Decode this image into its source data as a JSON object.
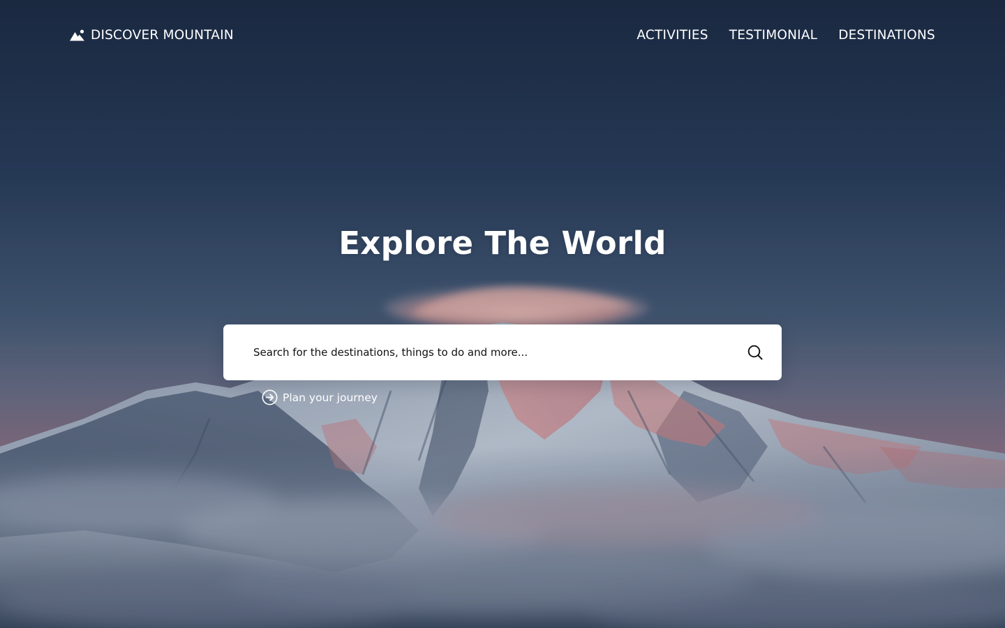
{
  "brand": {
    "name": "DISCOVER MOUNTAIN",
    "icon": "mountain-icon"
  },
  "nav": {
    "items": [
      {
        "label": "ACTIVITIES"
      },
      {
        "label": "TESTIMONIAL"
      },
      {
        "label": "DESTINATIONS"
      }
    ]
  },
  "hero": {
    "title": "Explore The World",
    "background": "snowy-mountain-photo"
  },
  "search": {
    "placeholder": "Search for the destinations, things to do and more...",
    "value": "",
    "button_icon": "search-icon"
  },
  "plan": {
    "label": "Plan your journey",
    "icon": "arrow-circle-right-icon"
  },
  "colors": {
    "sky_top": "#1e2c45",
    "sky_mid": "#3f5571",
    "alpenglow": "#d4787b",
    "search_bg": "#ffffff",
    "text_on_dark": "#ffffff",
    "text_on_light": "#111111"
  }
}
